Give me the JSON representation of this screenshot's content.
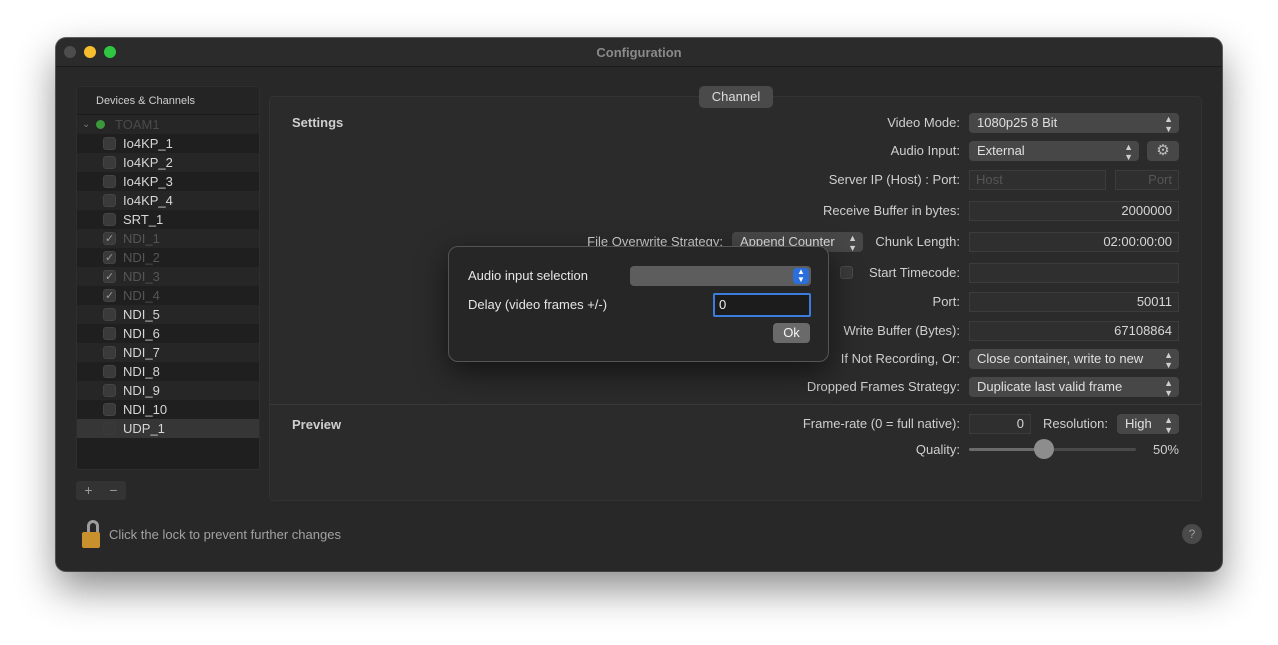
{
  "window": {
    "title": "Configuration"
  },
  "sidebar": {
    "header": "Devices & Channels",
    "root": "TOAM1",
    "items": [
      {
        "label": "Io4KP_1",
        "checked": false,
        "disabled": false
      },
      {
        "label": "Io4KP_2",
        "checked": false,
        "disabled": false
      },
      {
        "label": "Io4KP_3",
        "checked": false,
        "disabled": false
      },
      {
        "label": "Io4KP_4",
        "checked": false,
        "disabled": false
      },
      {
        "label": "SRT_1",
        "checked": false,
        "disabled": false
      },
      {
        "label": "NDI_1",
        "checked": true,
        "disabled": true
      },
      {
        "label": "NDI_2",
        "checked": true,
        "disabled": true
      },
      {
        "label": "NDI_3",
        "checked": true,
        "disabled": true
      },
      {
        "label": "NDI_4",
        "checked": true,
        "disabled": true
      },
      {
        "label": "NDI_5",
        "checked": false,
        "disabled": false
      },
      {
        "label": "NDI_6",
        "checked": false,
        "disabled": false
      },
      {
        "label": "NDI_7",
        "checked": false,
        "disabled": false
      },
      {
        "label": "NDI_8",
        "checked": false,
        "disabled": false
      },
      {
        "label": "NDI_9",
        "checked": false,
        "disabled": false
      },
      {
        "label": "NDI_10",
        "checked": false,
        "disabled": false
      },
      {
        "label": "UDP_1",
        "checked": false,
        "disabled": false,
        "selected": true
      }
    ],
    "add_label": "+",
    "remove_label": "−"
  },
  "tab": {
    "label": "Channel"
  },
  "settings": {
    "title": "Settings",
    "video_mode_label": "Video Mode:",
    "video_mode_value": "1080p25 8 Bit",
    "audio_input_label": "Audio Input:",
    "audio_input_value": "External",
    "server_ip_label": "Server IP (Host) : Port:",
    "host_placeholder": "Host",
    "port_placeholder": "Port",
    "receive_buffer_label": "Receive Buffer in bytes:",
    "receive_buffer_value": "2000000",
    "file_overwrite_label": "File Overwrite Strategy:",
    "file_overwrite_value": "Append Counter",
    "chunk_length_label": "Chunk Length:",
    "chunk_length_value": "02:00:00:00",
    "start_timecode_label": "Start Timecode:",
    "port_label": "Port:",
    "port_value": "50011",
    "write_buffer_label": "Write Buffer (Bytes):",
    "write_buffer_value": "67108864",
    "not_recording_label": "If Not Recording, Or:",
    "not_recording_value": "Close container, write to new",
    "dropped_frames_label": "Dropped Frames Strategy:",
    "dropped_frames_value": "Duplicate last valid frame"
  },
  "preview": {
    "title": "Preview",
    "framerate_label": "Frame-rate (0 = full native):",
    "framerate_value": "0",
    "resolution_label": "Resolution:",
    "resolution_value": "High",
    "quality_label": "Quality:",
    "quality_value": "50%",
    "quality_fraction": 0.45
  },
  "footer": {
    "lock_text": "Click the lock to prevent further changes",
    "help_label": "?"
  },
  "dialog": {
    "audio_selection_label": "Audio input selection",
    "delay_label": "Delay (video frames +/-)",
    "delay_value": "0",
    "ok_label": "Ok"
  }
}
